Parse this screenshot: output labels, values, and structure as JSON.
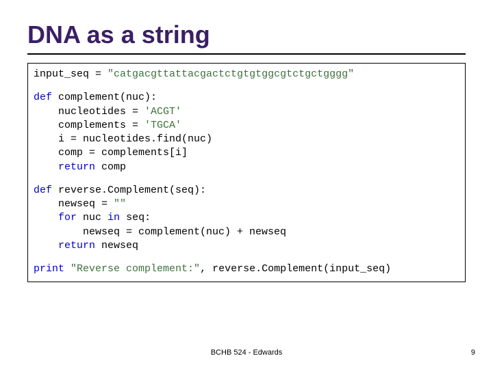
{
  "title": "DNA as a string",
  "code": {
    "l1a": "input_seq = ",
    "l1b": "\"catgacgttattacgactctgtgtggcgtctgctgggg\"",
    "l3a": "def",
    "l3b": " complement(nuc):",
    "l4a": "    nucleotides = ",
    "l4b": "'ACGT'",
    "l5a": "    complements = ",
    "l5b": "'TGCA'",
    "l6": "    i = nucleotides.find(nuc)",
    "l7": "    comp = complements[i]",
    "l8a": "    ",
    "l8b": "return",
    "l8c": " comp",
    "l10a": "def",
    "l10b": " reverse.Complement(seq):",
    "l11a": "    newseq = ",
    "l11b": "\"\"",
    "l12a": "    ",
    "l12b": "for",
    "l12c": " nuc ",
    "l12d": "in",
    "l12e": " seq:",
    "l13": "        newseq = complement(nuc) + newseq",
    "l14a": "    ",
    "l14b": "return",
    "l14c": " newseq",
    "l16a": "print",
    "l16b": " ",
    "l16c": "\"Reverse complement:\"",
    "l16d": ", reverse.Complement(input_seq)"
  },
  "footer": "BCHB 524 - Edwards",
  "pagenum": "9"
}
